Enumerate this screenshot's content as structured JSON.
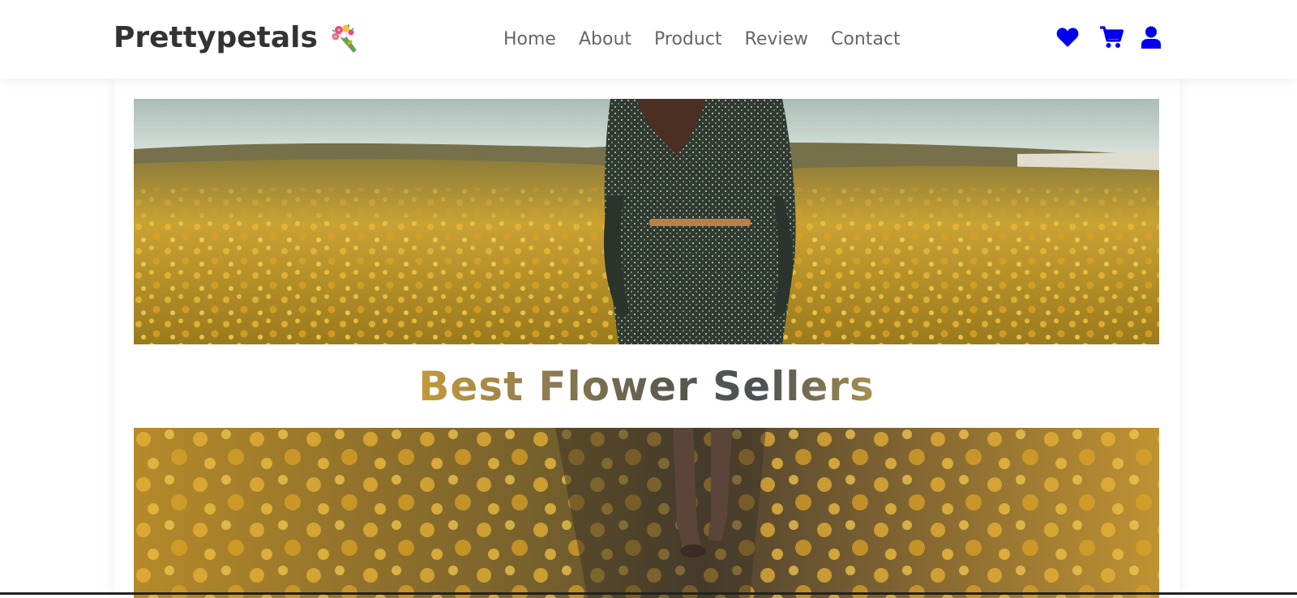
{
  "brand": {
    "name": "Prettypetals",
    "emoji_icon": "bouquet-icon"
  },
  "nav": {
    "links": [
      {
        "label": "Home"
      },
      {
        "label": "About"
      },
      {
        "label": "Product"
      },
      {
        "label": "Review"
      },
      {
        "label": "Contact"
      }
    ],
    "icons": [
      {
        "name": "heart-icon"
      },
      {
        "name": "cart-icon"
      },
      {
        "name": "user-icon"
      }
    ],
    "icon_color": "#0000ee"
  },
  "hero": {
    "heading": "Best Flower Sellers"
  },
  "colors": {
    "brand_text": "#333333",
    "nav_text": "#666666",
    "flower_yellow": "#d9a42a",
    "sky": "#c9d8d6"
  }
}
